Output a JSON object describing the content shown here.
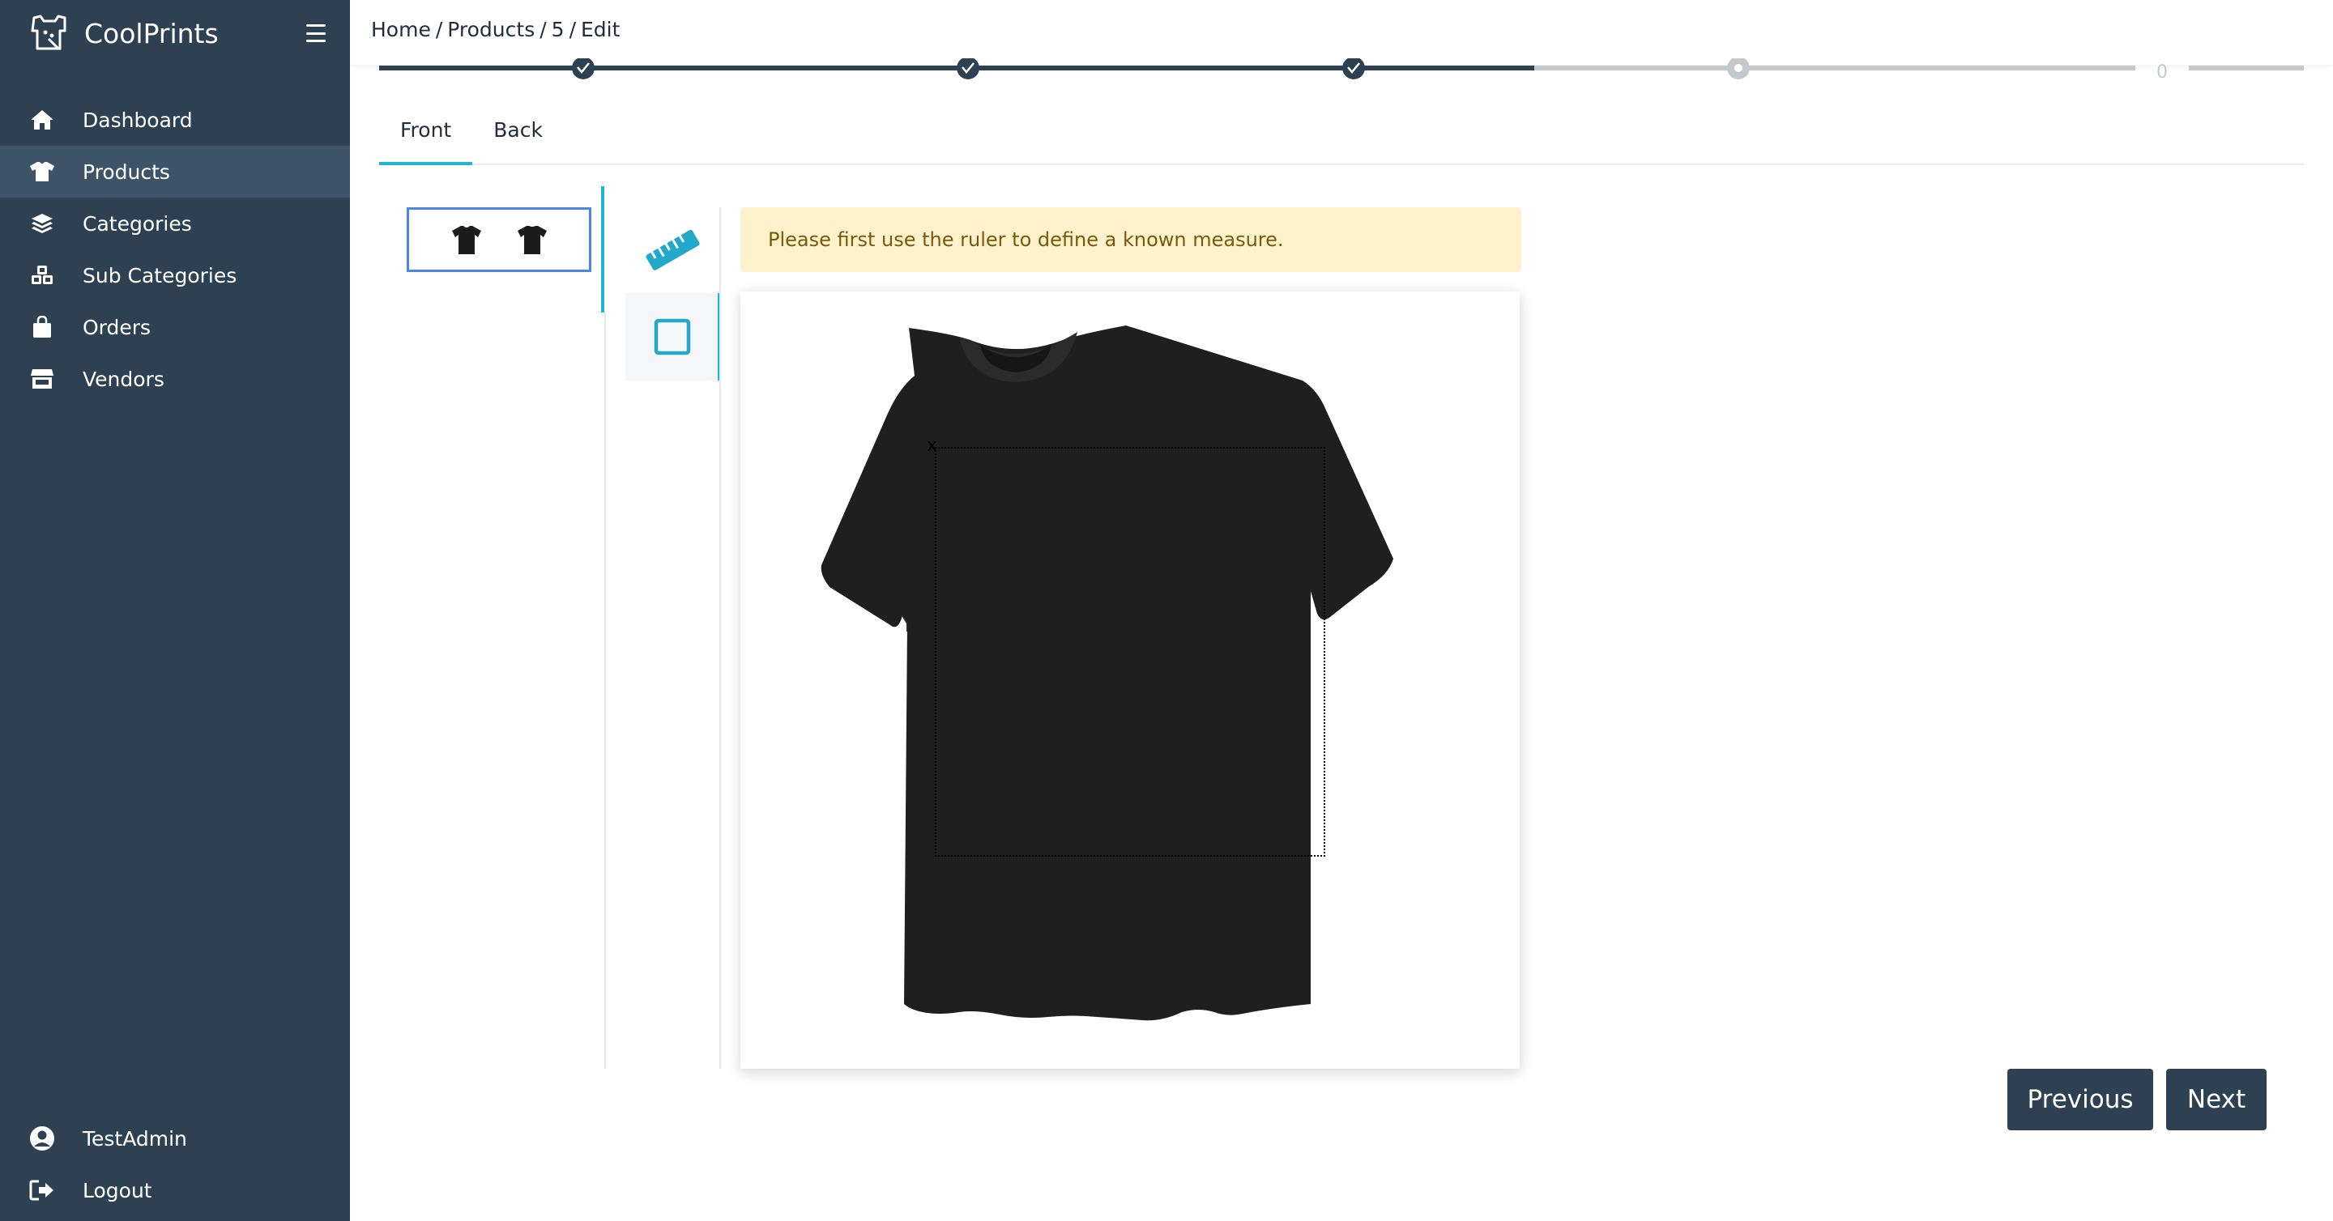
{
  "app": {
    "brand": "CoolPrints"
  },
  "sidebar": {
    "items": [
      {
        "label": "Dashboard",
        "icon": "home-icon"
      },
      {
        "label": "Products",
        "icon": "tshirt-icon",
        "active": true
      },
      {
        "label": "Categories",
        "icon": "layers-icon"
      },
      {
        "label": "Sub Categories",
        "icon": "cubes-icon"
      },
      {
        "label": "Orders",
        "icon": "shopping-bag-icon"
      },
      {
        "label": "Vendors",
        "icon": "store-icon"
      }
    ],
    "bottom": [
      {
        "label": "TestAdmin",
        "icon": "user-circle-icon"
      },
      {
        "label": "Logout",
        "icon": "logout-icon"
      }
    ]
  },
  "breadcrumb": {
    "home": "Home",
    "products": "Products",
    "id": "5",
    "edit": "Edit"
  },
  "stepper": {
    "steps_completed": 3,
    "current_step": 4,
    "total_steps": 5,
    "last_step_label": "0"
  },
  "tabs": [
    {
      "label": "Front",
      "active": true
    },
    {
      "label": "Back",
      "active": false
    }
  ],
  "alert": {
    "text": "Please first use the ruler to define a known measure."
  },
  "print_area": {
    "marker": "x"
  },
  "buttons": {
    "previous": "Previous",
    "next": "Next"
  },
  "colors": {
    "sidebar": "#2e4153",
    "sidebar_active": "#3d5468",
    "accent": "#22b4d8",
    "alert_bg": "#fef2cc",
    "button": "#2e4153"
  }
}
